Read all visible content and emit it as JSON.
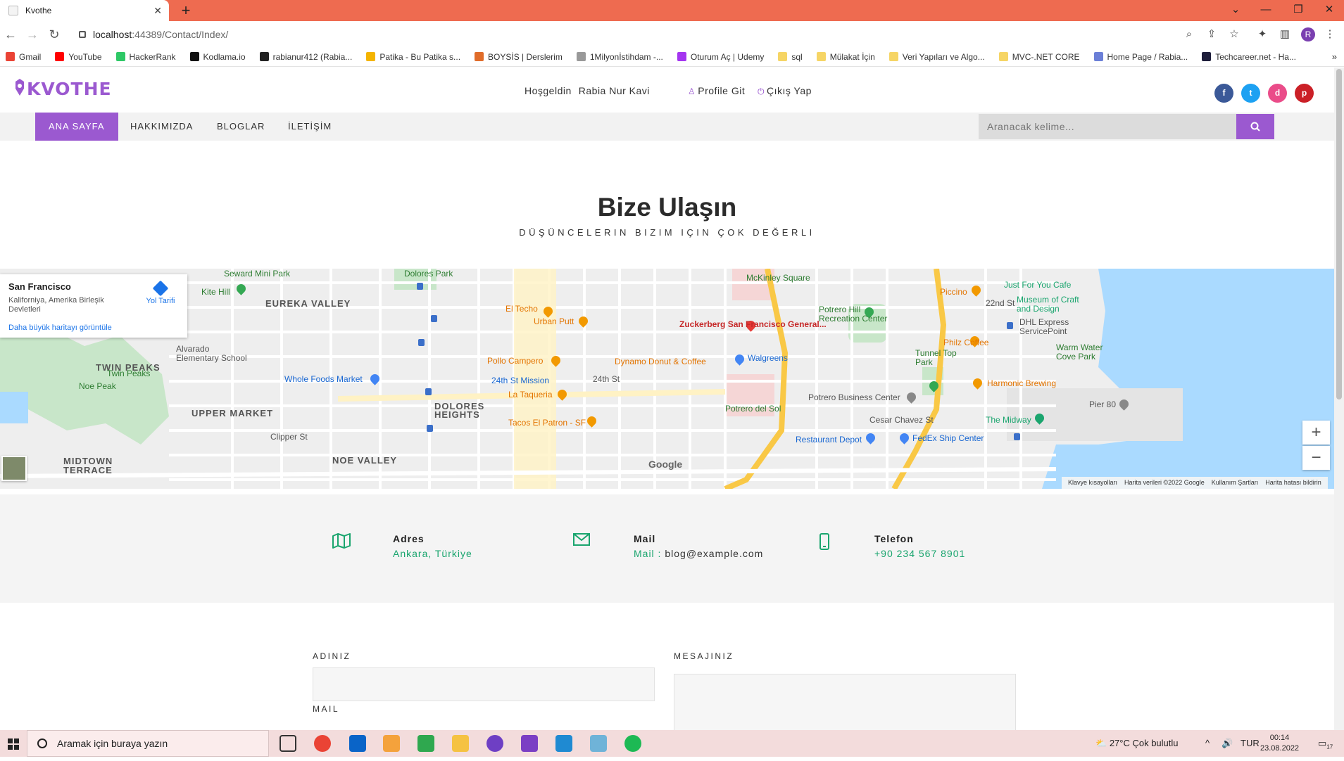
{
  "browser": {
    "tab_title": "Kvothe",
    "url_host": "localhost",
    "url_path": ":44389/Contact/Index/",
    "profile_initial": "R",
    "bookmarks": [
      "Gmail",
      "YouTube",
      "HackerRank",
      "Kodlama.io",
      "rabianur412 (Rabia...",
      "Patika - Bu Patika s...",
      "BOYSİS | Derslerim",
      "1Milyonİstihdam -...",
      "Oturum Aç | Udemy",
      "sql",
      "Mülakat İçin",
      "Veri Yapıları ve Algo...",
      "MVC-.NET CORE",
      "Home Page / Rabia...",
      "Techcareer.net - Ha..."
    ],
    "bookmark_colors": [
      "#ea4335",
      "#ff0000",
      "#2ec866",
      "#111111",
      "#222222",
      "#f4b400",
      "#e06c2a",
      "#999999",
      "#a435f0",
      "#f6d565",
      "#f6d565",
      "#f6d565",
      "#f6d565",
      "#6b7fd7",
      "#1d1d3a"
    ]
  },
  "site": {
    "logo": "KVOTHE",
    "welcome": "Hoşgeldin",
    "user_name": "Rabia Nur Kavi",
    "profile_link": "Profile Git",
    "logout_link": "Çıkış Yap",
    "social": [
      {
        "name": "facebook",
        "glyph": "f",
        "color": "#3b5998"
      },
      {
        "name": "twitter",
        "glyph": "t",
        "color": "#1da1f2"
      },
      {
        "name": "dribbble",
        "glyph": "d",
        "color": "#ea4c89"
      },
      {
        "name": "pinterest",
        "glyph": "p",
        "color": "#cb2027"
      }
    ],
    "nav": [
      "ANA SAYFA",
      "HAKKIMIZDA",
      "BLOGLAR",
      "İLETİŞİM"
    ],
    "search_placeholder": "Aranacak kelime...",
    "accent_color": "#9b59d0"
  },
  "contact": {
    "title": "Bize Ulaşın",
    "subtitle": "DÜŞÜNCELERIN BIZIM IÇIN ÇOK DEĞERLI",
    "map": {
      "place_name": "San Francisco",
      "place_address": "Kaliforniya, Amerika Birleşik Devletleri",
      "directions": "Yol Tarifi",
      "bigger_map": "Daha büyük haritayı görüntüle",
      "zoom_in": "+",
      "zoom_out": "−",
      "google": "Google",
      "attribution": [
        "Klavye kısayolları",
        "Harita verileri ©2022 Google",
        "Kullanım Şartları",
        "Harita hatası bildirin"
      ],
      "areas": [
        "EUREKA VALLEY",
        "TWIN PEAKS",
        "UPPER MARKET",
        "DOLORES",
        "HEIGHTS",
        "NOE VALLEY",
        "MIDTOWN",
        "TERRACE"
      ],
      "pois": [
        "Seward Mini Park",
        "Kite Hill",
        "Dolores Park",
        "McKinley Square",
        "Zuckerberg San Francisco General...",
        "El Techo",
        "Urban Putt",
        "Pollo Campero",
        "Dynamo Donut & Coffee",
        "Walgreens",
        "Whole Foods Market",
        "24th St Mission",
        "La Taqueria",
        "Tacos El Patron - SF",
        "Potrero Hill Recreation Center",
        "Piccino",
        "Just For You Cafe",
        "Museum of Craft and Design",
        "DHL Express ServicePoint",
        "Philz Coffee",
        "Tunnel Top Park",
        "Warm Water Cove Park",
        "Harmonic Brewing",
        "Potrero Business Center",
        "Pier 80",
        "The Midway",
        "Potrero del Sol",
        "Restaurant Depot",
        "FedEx Ship Center",
        "Noe Peak",
        "Twin Peaks",
        "Alvarado Elementary School",
        "Cesar Chavez St",
        "Clipper St",
        "24th St",
        "22nd St"
      ]
    },
    "info": [
      {
        "title": "Adres",
        "value": "Ankara, Türkiye"
      },
      {
        "title": "Mail",
        "prefix": "Mail :",
        "value": "blog@example.com"
      },
      {
        "title": "Telefon",
        "value": "+90 234 567 8901"
      }
    ],
    "icon_color": "#1aa56e",
    "form": {
      "name_label": "ADINIZ",
      "message_label": "MESAJINIZ",
      "mail_label": "MAIL"
    }
  },
  "taskbar": {
    "search_placeholder": "Aramak için buraya yazın",
    "weather": "27°C  Çok bulutlu",
    "lang": "TUR",
    "time": "00:14",
    "date": "23.08.2022",
    "notifications": "17"
  }
}
